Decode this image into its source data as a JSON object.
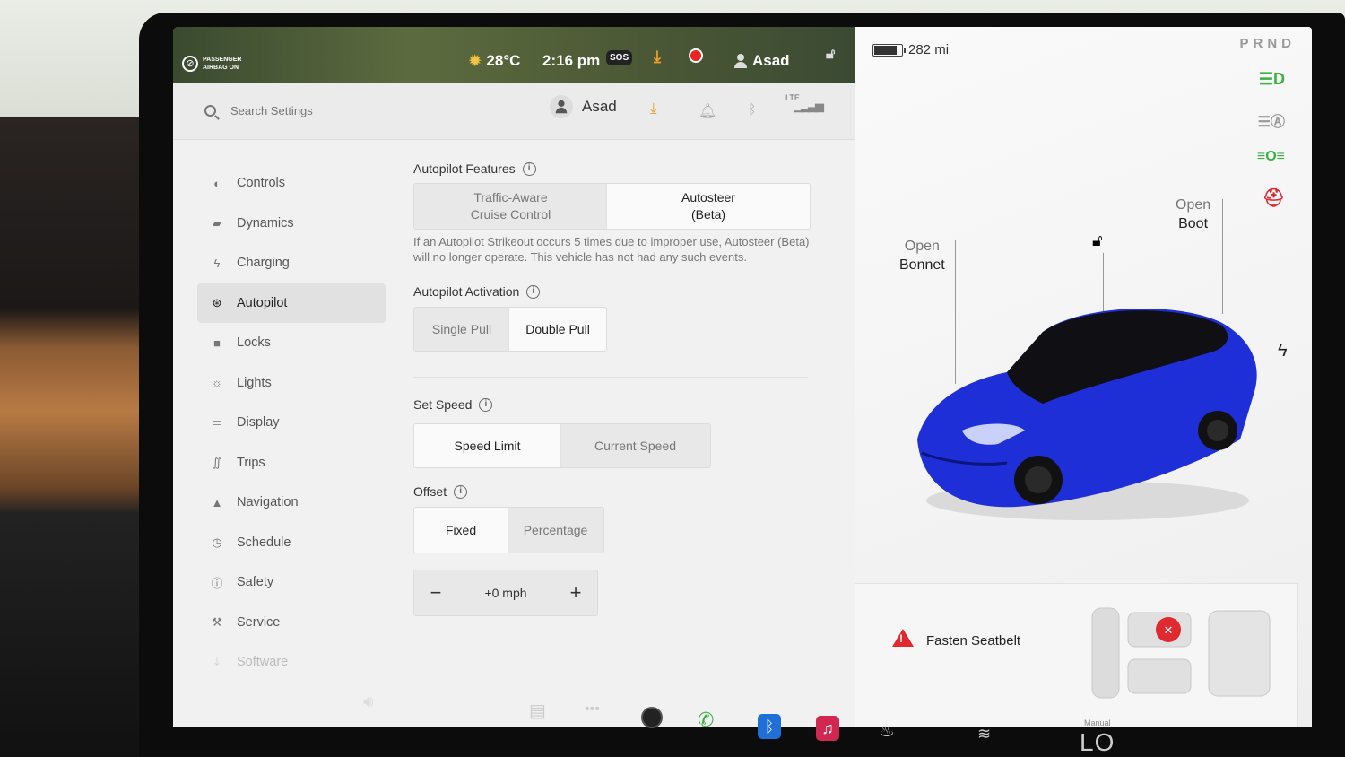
{
  "status_bar": {
    "airbag_line1": "PASSENGER",
    "airbag_line2": "AIRBAG ON",
    "temperature": "28°C",
    "time": "2:16 pm",
    "sos_label": "SOS",
    "user": "Asad"
  },
  "header": {
    "search_placeholder": "Search Settings",
    "user": "Asad",
    "network_label": "LTE"
  },
  "sidebar": {
    "items": [
      {
        "label": "Controls",
        "icon": "toggle-icon"
      },
      {
        "label": "Dynamics",
        "icon": "car-icon"
      },
      {
        "label": "Charging",
        "icon": "bolt-icon"
      },
      {
        "label": "Autopilot",
        "icon": "steering-wheel-icon",
        "active": true
      },
      {
        "label": "Locks",
        "icon": "lock-icon"
      },
      {
        "label": "Lights",
        "icon": "sun-icon"
      },
      {
        "label": "Display",
        "icon": "display-icon"
      },
      {
        "label": "Trips",
        "icon": "trips-icon"
      },
      {
        "label": "Navigation",
        "icon": "navigation-icon"
      },
      {
        "label": "Schedule",
        "icon": "clock-icon"
      },
      {
        "label": "Safety",
        "icon": "safety-icon"
      },
      {
        "label": "Service",
        "icon": "wrench-icon"
      },
      {
        "label": "Software",
        "icon": "download-icon"
      }
    ]
  },
  "autopilot": {
    "features_title": "Autopilot Features",
    "features_options": [
      {
        "line1": "Traffic-Aware",
        "line2": "Cruise Control",
        "selected": false
      },
      {
        "line1": "Autosteer",
        "line2": "(Beta)",
        "selected": true
      }
    ],
    "features_description": "If an Autopilot Strikeout occurs 5 times due to improper use, Autosteer (Beta) will no longer operate. This vehicle has not had any such events.",
    "activation_title": "Autopilot Activation",
    "activation_options": [
      {
        "label": "Single Pull",
        "selected": false
      },
      {
        "label": "Double Pull",
        "selected": true
      }
    ],
    "set_speed_title": "Set Speed",
    "set_speed_options": [
      {
        "label": "Speed Limit",
        "selected": true
      },
      {
        "label": "Current Speed",
        "selected": false
      }
    ],
    "offset_title": "Offset",
    "offset_options": [
      {
        "label": "Fixed",
        "selected": true
      },
      {
        "label": "Percentage",
        "selected": false
      }
    ],
    "offset_value": "+0 mph",
    "minus_label": "−",
    "plus_label": "+"
  },
  "vehicle": {
    "range": "282 mi",
    "gear": "PRND",
    "open_bonnet_line1": "Open",
    "open_bonnet_line2": "Bonnet",
    "open_boot_line1": "Open",
    "open_boot_line2": "Boot",
    "car_color": "#1f2fd8",
    "alert": "Fasten Seatbelt",
    "alert_color": "#e0282f"
  },
  "dock": {
    "climate_mode": "Manual",
    "temperature": "LO"
  },
  "colors": {
    "accent_green": "#3cb043",
    "alert_red": "#e0282f",
    "download_orange": "#f0a030"
  }
}
